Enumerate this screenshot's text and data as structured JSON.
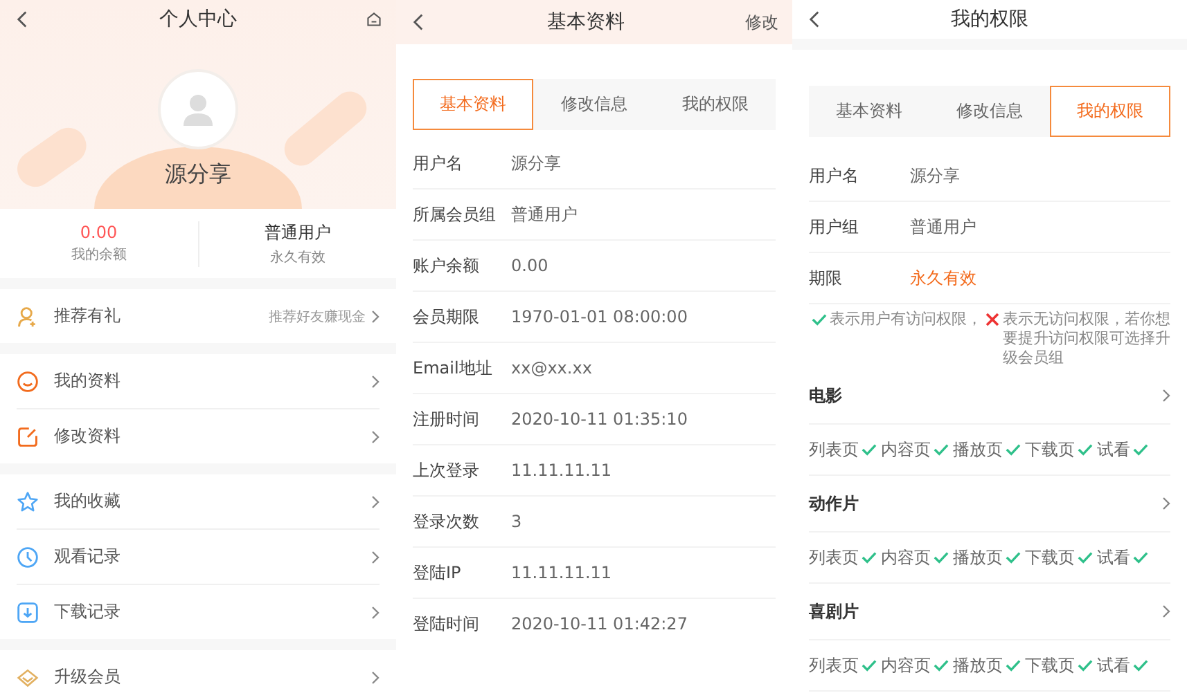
{
  "profile_page": {
    "title": "个人中心",
    "user_name": "源分享",
    "stats": [
      {
        "value": "0.00",
        "label": "我的余额"
      },
      {
        "value": "普通用户",
        "label": "永久有效"
      }
    ],
    "menu_groups": [
      {
        "items": [
          {
            "label": "推荐有礼",
            "hint": "推荐好友赚现金"
          }
        ]
      },
      {
        "items": [
          {
            "label": "我的资料"
          },
          {
            "label": "修改资料"
          }
        ]
      },
      {
        "items": [
          {
            "label": "我的收藏"
          },
          {
            "label": "观看记录"
          },
          {
            "label": "下载记录"
          }
        ]
      },
      {
        "items": [
          {
            "label": "升级会员"
          }
        ]
      }
    ]
  },
  "basic_info_page": {
    "title": "基本资料",
    "action": "修改",
    "tabs": [
      {
        "label": "基本资料",
        "selected": true
      },
      {
        "label": "修改信息",
        "selected": false
      },
      {
        "label": "我的权限",
        "selected": false
      }
    ],
    "fields": [
      {
        "label": "用户名",
        "value": "源分享"
      },
      {
        "label": "所属会员组",
        "value": "普通用户"
      },
      {
        "label": "账户余额",
        "value": "0.00"
      },
      {
        "label": "会员期限",
        "value": "1970-01-01 08:00:00"
      },
      {
        "label": "Email地址",
        "value": "xx@xx.xx"
      },
      {
        "label": "注册时间",
        "value": "2020-10-11 01:35:10"
      },
      {
        "label": "上次登录",
        "value": "11.11.11.11"
      },
      {
        "label": "登录次数",
        "value": "3"
      },
      {
        "label": "登陆IP",
        "value": "11.11.11.11"
      },
      {
        "label": "登陆时间",
        "value": "2020-10-11 01:42:27"
      }
    ]
  },
  "permissions_page": {
    "title": "我的权限",
    "tabs": [
      {
        "label": "基本资料",
        "selected": false
      },
      {
        "label": "修改信息",
        "selected": false
      },
      {
        "label": "我的权限",
        "selected": true
      }
    ],
    "fields": [
      {
        "label": "用户名",
        "value": "源分享",
        "emphasis": false
      },
      {
        "label": "用户组",
        "value": "普通用户",
        "emphasis": false
      },
      {
        "label": "期限",
        "value": "永久有效",
        "emphasis": true
      }
    ],
    "legend": {
      "allowed_text": "表示用户有访问权限，",
      "denied_text": "表示无访问权限，若你想要提升访问权限可选择升级会员组"
    },
    "categories": [
      {
        "name": "电影",
        "permissions": [
          {
            "label": "列表页",
            "allowed": true
          },
          {
            "label": "内容页",
            "allowed": true
          },
          {
            "label": "播放页",
            "allowed": true
          },
          {
            "label": "下载页",
            "allowed": true
          },
          {
            "label": "试看",
            "allowed": true
          }
        ]
      },
      {
        "name": "动作片",
        "permissions": [
          {
            "label": "列表页",
            "allowed": true
          },
          {
            "label": "内容页",
            "allowed": true
          },
          {
            "label": "播放页",
            "allowed": true
          },
          {
            "label": "下载页",
            "allowed": true
          },
          {
            "label": "试看",
            "allowed": true
          }
        ]
      },
      {
        "name": "喜剧片",
        "permissions": [
          {
            "label": "列表页",
            "allowed": true
          },
          {
            "label": "内容页",
            "allowed": true
          },
          {
            "label": "播放页",
            "allowed": true
          },
          {
            "label": "下载页",
            "allowed": true
          },
          {
            "label": "试看",
            "allowed": true
          }
        ]
      }
    ]
  }
}
